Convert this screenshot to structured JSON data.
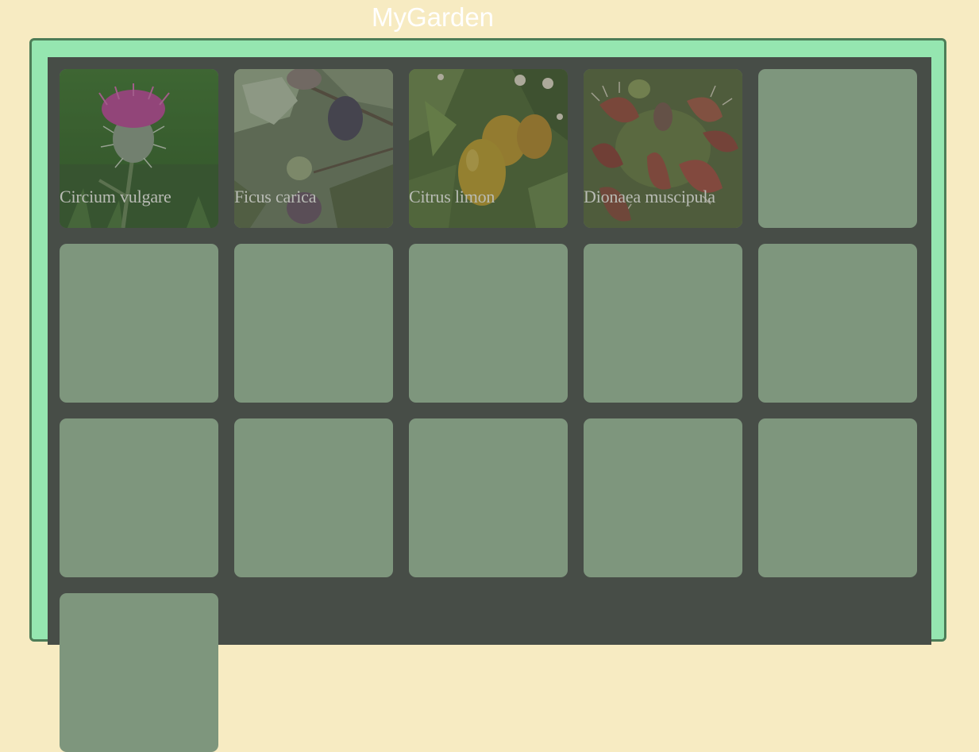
{
  "app": {
    "title": "MyGarden"
  },
  "colors": {
    "page_background": "#f7ebc2",
    "frame_fill": "#95e6b0",
    "frame_border": "#4d7d57",
    "board_fill": "#474d47",
    "empty_slot": "#7e967d",
    "plant_label": "#b9bcb5",
    "title_text": "#ffffff"
  },
  "garden": {
    "plants": [
      {
        "name": "Circium vulgare",
        "image": "thistle-photo"
      },
      {
        "name": "Ficus carica",
        "image": "fig-photo"
      },
      {
        "name": "Citrus limon",
        "image": "lemon-photo"
      },
      {
        "name": "Dionaea muscipula",
        "image": "venus-flytrap-photo"
      }
    ],
    "empty_slots": 12
  }
}
